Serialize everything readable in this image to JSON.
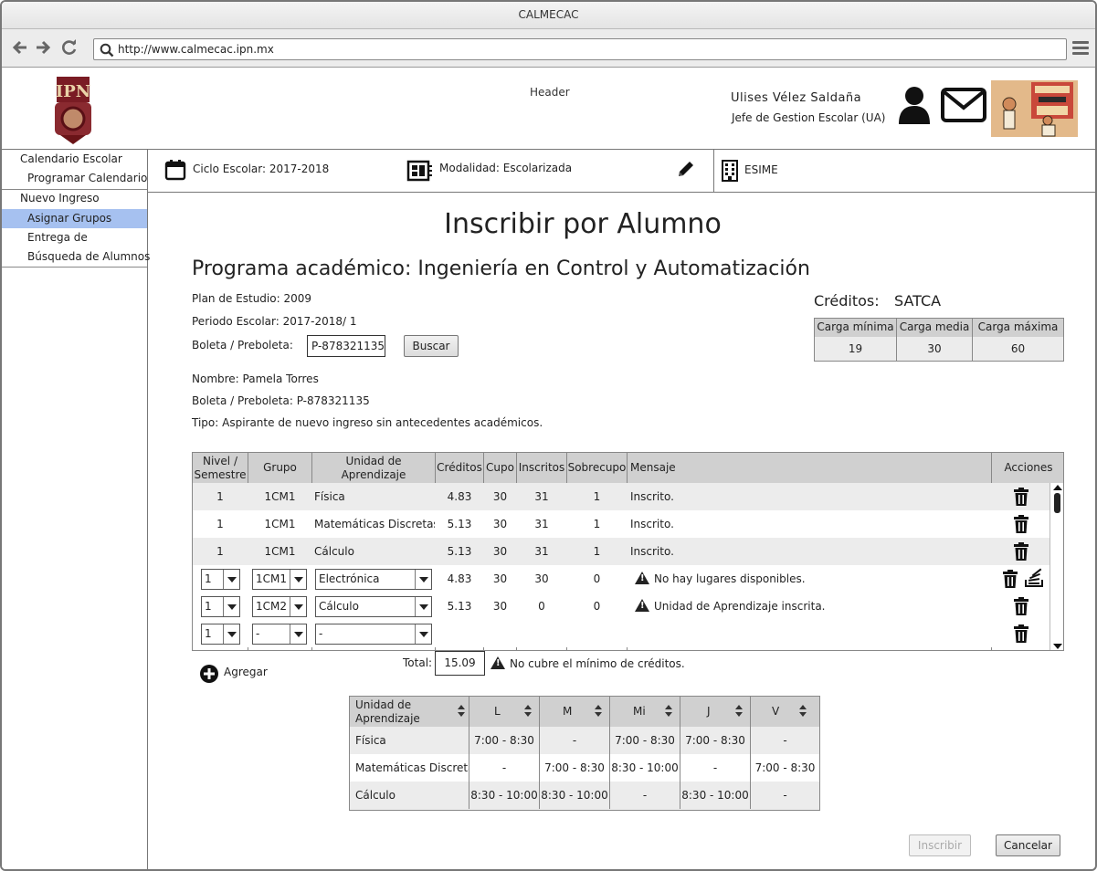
{
  "browser": {
    "title": "CALMECAC",
    "url": "http://www.calmecac.ipn.mx"
  },
  "header": {
    "logo_text": "IPN",
    "label": "Header",
    "user_name": "Ulises Vélez Saldaña",
    "user_role": "Jefe de Gestion Escolar (UA)"
  },
  "sidebar": {
    "items": [
      {
        "label": "Calendario Escolar"
      },
      {
        "label": "Programar Calendario"
      },
      {
        "label": "Nuevo Ingreso"
      },
      {
        "label": "Asignar Grupos"
      },
      {
        "label": "Entrega de"
      },
      {
        "label": "Búsqueda de Alumnos"
      }
    ],
    "active_index": 3
  },
  "infobar": {
    "ciclo": "Ciclo Escolar:  2017-2018",
    "modalidad": "Modalidad:  Escolarizada",
    "escuela": "ESIME"
  },
  "main": {
    "title": "Inscribir por Alumno",
    "program": "Programa académico: Ingeniería en Control y Automatización",
    "plan": "Plan de Estudio:   2009",
    "periodo": "Periodo Escolar:   2017-2018/ 1",
    "boleta_label": "Boleta / Preboleta:",
    "boleta_value": "P-878321135",
    "buscar": "Buscar",
    "nombre": "Nombre:  Pamela Torres",
    "boleta_info": "Boleta / Preboleta: P-878321135",
    "tipo": "Tipo:  Aspirante de nuevo ingreso sin antecedentes académicos."
  },
  "creditos": {
    "label": "Créditos:",
    "sistema": "SATCA",
    "headers": [
      "Carga mínima",
      "Carga media",
      "Carga máxima"
    ],
    "values": [
      "19",
      "30",
      "60"
    ]
  },
  "grid": {
    "headers": [
      "Nivel / Semestre",
      "Grupo",
      "Unidad de Aprendizaje",
      "Créditos",
      "Cupo",
      "Inscritos",
      "Sobrecupo",
      "Mensaje",
      "Acciones"
    ],
    "rows": [
      {
        "nivel": "1",
        "grupo": "1CM1",
        "unidad": "Física",
        "creditos": "4.83",
        "cupo": "30",
        "inscritos": "31",
        "sobrecupo": "1",
        "mensaje": "Inscrito."
      },
      {
        "nivel": "1",
        "grupo": "1CM1",
        "unidad": "Matemáticas Discretas",
        "creditos": "5.13",
        "cupo": "30",
        "inscritos": "31",
        "sobrecupo": "1",
        "mensaje": "Inscrito."
      },
      {
        "nivel": "1",
        "grupo": "1CM1",
        "unidad": "Cálculo",
        "creditos": "5.13",
        "cupo": "30",
        "inscritos": "31",
        "sobrecupo": "1",
        "mensaje": "Inscrito."
      },
      {
        "nivel": "1",
        "grupo": "1CM1",
        "unidad": "Electrónica",
        "creditos": "4.83",
        "cupo": "30",
        "inscritos": "30",
        "sobrecupo": "0",
        "mensaje": "No hay lugares disponibles."
      },
      {
        "nivel": "1",
        "grupo": "1CM2",
        "unidad": "Cálculo",
        "creditos": "5.13",
        "cupo": "30",
        "inscritos": "0",
        "sobrecupo": "0",
        "mensaje": "Unidad de Aprendizaje inscrita."
      },
      {
        "nivel": "1",
        "grupo": "-",
        "unidad": "-",
        "creditos": "",
        "cupo": "",
        "inscritos": "",
        "sobrecupo": "",
        "mensaje": ""
      }
    ],
    "total_label": "Total:",
    "total_value": "15.09",
    "total_warning": "No cubre el mínimo de créditos.",
    "add_label": "Agregar"
  },
  "schedule": {
    "headers": [
      "Unidad de Aprendizaje",
      "L",
      "M",
      "Mi",
      "J",
      "V"
    ],
    "rows": [
      {
        "unidad": "Física",
        "L": "7:00 - 8:30",
        "M": "-",
        "Mi": "7:00 - 8:30",
        "J": "7:00 - 8:30",
        "V": "-"
      },
      {
        "unidad": "Matemáticas Discretas",
        "L": "-",
        "M": "7:00 - 8:30",
        "Mi": "8:30 - 10:00",
        "J": "-",
        "V": "7:00 - 8:30"
      },
      {
        "unidad": "Cálculo",
        "L": "8:30 - 10:00",
        "M": "8:30 - 10:00",
        "Mi": "-",
        "J": "8:30 - 10:00",
        "V": "-"
      }
    ]
  },
  "actions": {
    "inscribir": "Inscribir",
    "cancelar": "Cancelar"
  },
  "colors": {
    "active_sidebar": "#a6c1f0",
    "header_gray": "#d0d0d0",
    "row_alt": "#ececec"
  }
}
